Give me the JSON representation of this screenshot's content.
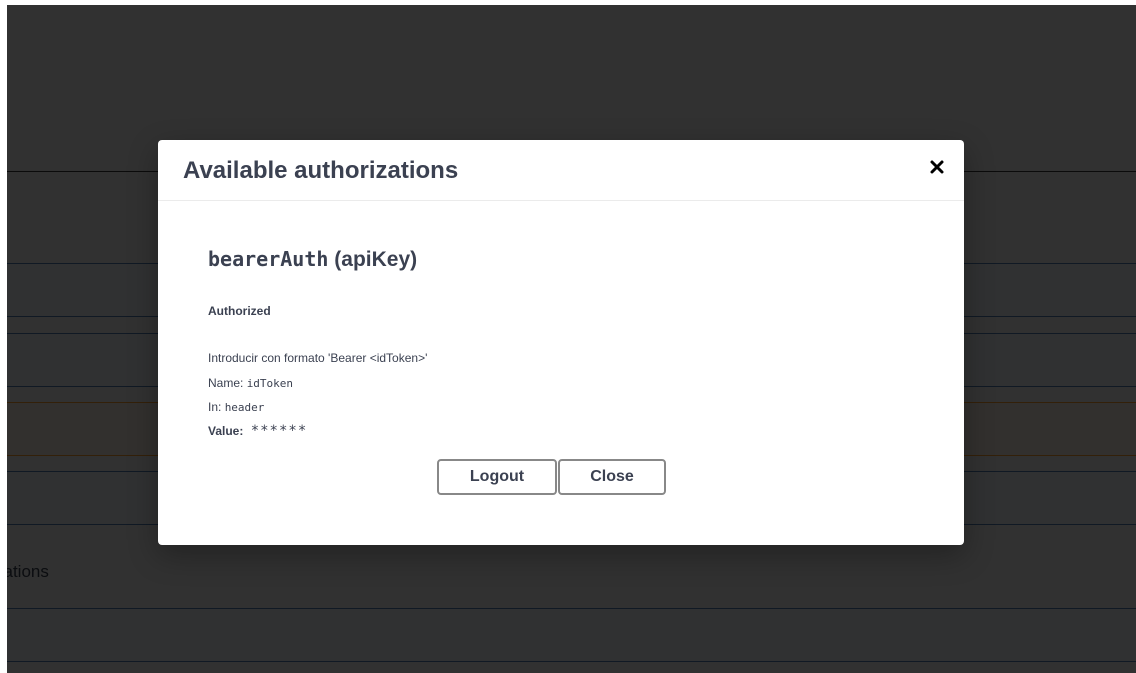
{
  "background": {
    "partial_text": "cations",
    "colors": {
      "line": "#4f7cb4",
      "warn_band": "#fca130",
      "overlay": "rgba(0,0,0,0.8)"
    }
  },
  "modal": {
    "title": "Available authorizations",
    "close_icon": "close-icon",
    "auth": {
      "scheme_name": "bearerAuth",
      "scheme_type": "(apiKey)",
      "status": "Authorized",
      "description": "Introducir con formato 'Bearer <idToken>'",
      "name_label": "Name:",
      "name_value": "idToken",
      "in_label": "In:",
      "in_value": "header",
      "value_label": "Value:",
      "value_masked": "******"
    },
    "buttons": {
      "logout": "Logout",
      "close": "Close"
    }
  }
}
